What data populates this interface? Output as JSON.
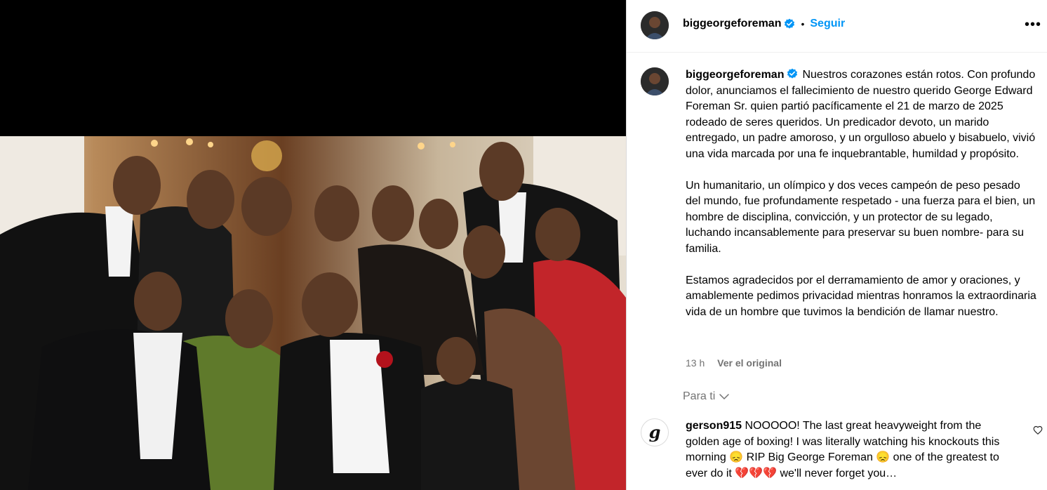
{
  "header": {
    "username": "biggeorgeforeman",
    "separator": "•",
    "follow_label": "Seguir",
    "more_label": "•••"
  },
  "caption": {
    "username": "biggeorgeforeman",
    "paragraphs": [
      "Nuestros corazones están rotos. Con profundo dolor, anunciamos el fallecimiento de nuestro querido George Edward Foreman Sr. quien partió pacíficamente el 21 de marzo de 2025 rodeado de seres queridos. Un predicador devoto, un marido entregado, un padre amoroso, y un orgulloso abuelo y bisabuelo, vivió una vida marcada por una fe inquebrantable, humildad y propósito.",
      "Un humanitario, un olímpico y dos veces campeón de peso pesado del mundo, fue profundamente respetado - una fuerza para el bien, un hombre de disciplina, convicción, y un protector de su legado, luchando incansablemente para preservar su buen nombre- para su familia.",
      "Estamos agradecidos por el derramamiento de amor y oraciones, y amablemente pedimos privacidad mientras honramos la extraordinaria vida de un hombre que tuvimos la bendición de llamar nuestro."
    ],
    "time": "13 h",
    "see_original": "Ver el original"
  },
  "filter": {
    "label": "Para ti"
  },
  "comment": {
    "username": "gerson915",
    "text_1": "NOOOOO! The last great heavyweight from the golden age of boxing! I was literally watching his knockouts this morning",
    "text_2": " RIP Big George Foreman ",
    "text_3": " one of the greatest to ever do it ",
    "text_4": " we'll never forget you…",
    "emoji_sad": "😞",
    "emoji_heart": "💔"
  },
  "colors": {
    "accent": "#0095f6",
    "verified": "#0095f6",
    "muted": "#737373",
    "heart": "#e0245e"
  }
}
